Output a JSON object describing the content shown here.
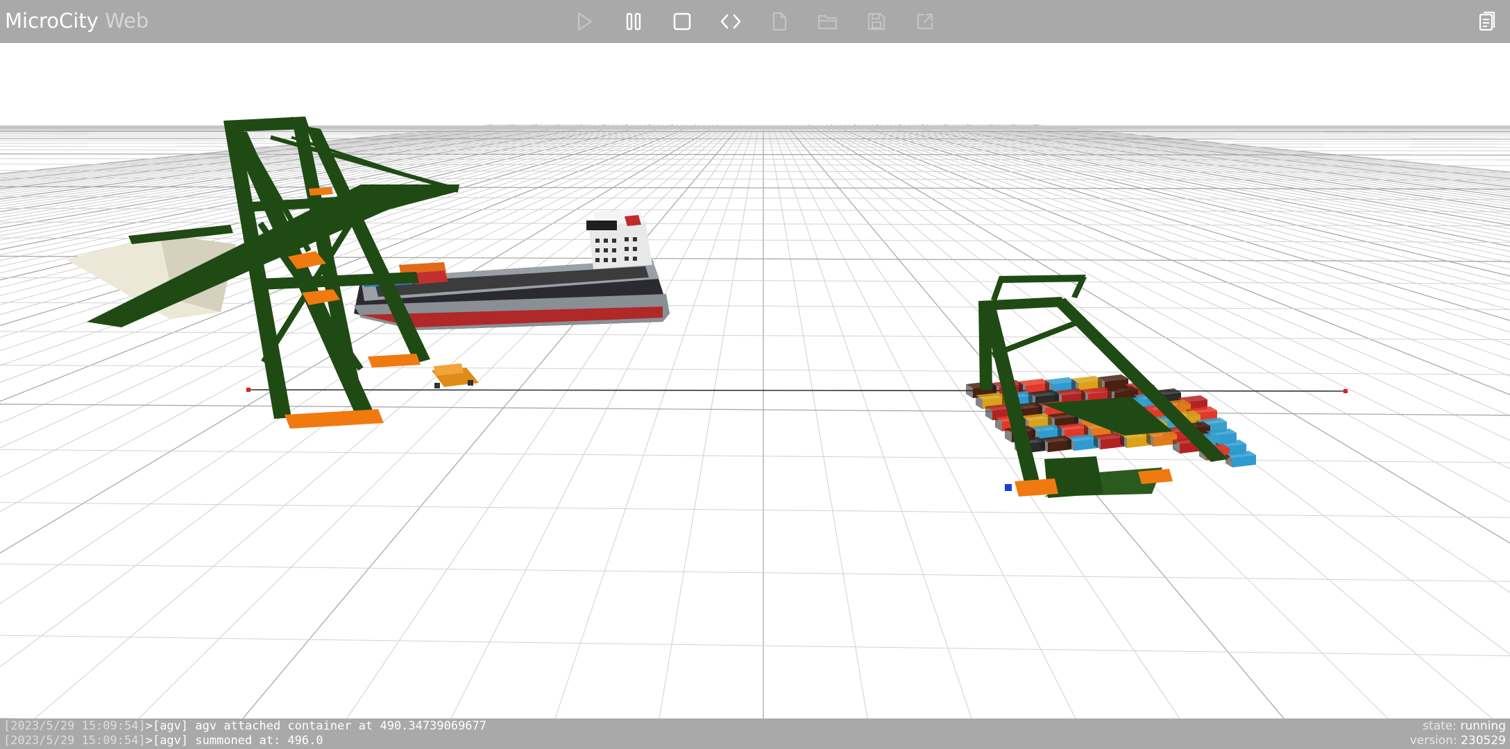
{
  "app": {
    "title_main": "MicroCity",
    "title_sub": "Web"
  },
  "toolbar": {
    "buttons": [
      {
        "name": "play",
        "icon": "play-icon",
        "enabled": false
      },
      {
        "name": "pause",
        "icon": "pause-icon",
        "enabled": true
      },
      {
        "name": "stop",
        "icon": "stop-icon",
        "enabled": true
      },
      {
        "name": "code",
        "icon": "code-icon",
        "enabled": true
      },
      {
        "name": "new-file",
        "icon": "file-icon",
        "enabled": false
      },
      {
        "name": "open-folder",
        "icon": "folder-open-icon",
        "enabled": false
      },
      {
        "name": "save",
        "icon": "save-icon",
        "enabled": false
      },
      {
        "name": "share",
        "icon": "share-icon",
        "enabled": false
      }
    ],
    "right_icon": "clipboard-icon"
  },
  "console": {
    "lines": [
      {
        "timestamp": "[2023/5/29 15:09:54]",
        "prompt": ">",
        "tag": "[agv]",
        "text": " agv attached container at 490.34739069677"
      },
      {
        "timestamp": "[2023/5/29 15:09:54]",
        "prompt": ">",
        "tag": "[agv]",
        "text": " summoned at: 496.0"
      }
    ]
  },
  "status": {
    "state_label": "state:",
    "state_value": "running",
    "version_label": "version:",
    "version_value": "230529"
  },
  "colors": {
    "toolbar_bg": "#a9a9a9",
    "crane_green": "#1f4a14",
    "crane_orange": "#f07a10",
    "grid": "#c8c8c8"
  }
}
